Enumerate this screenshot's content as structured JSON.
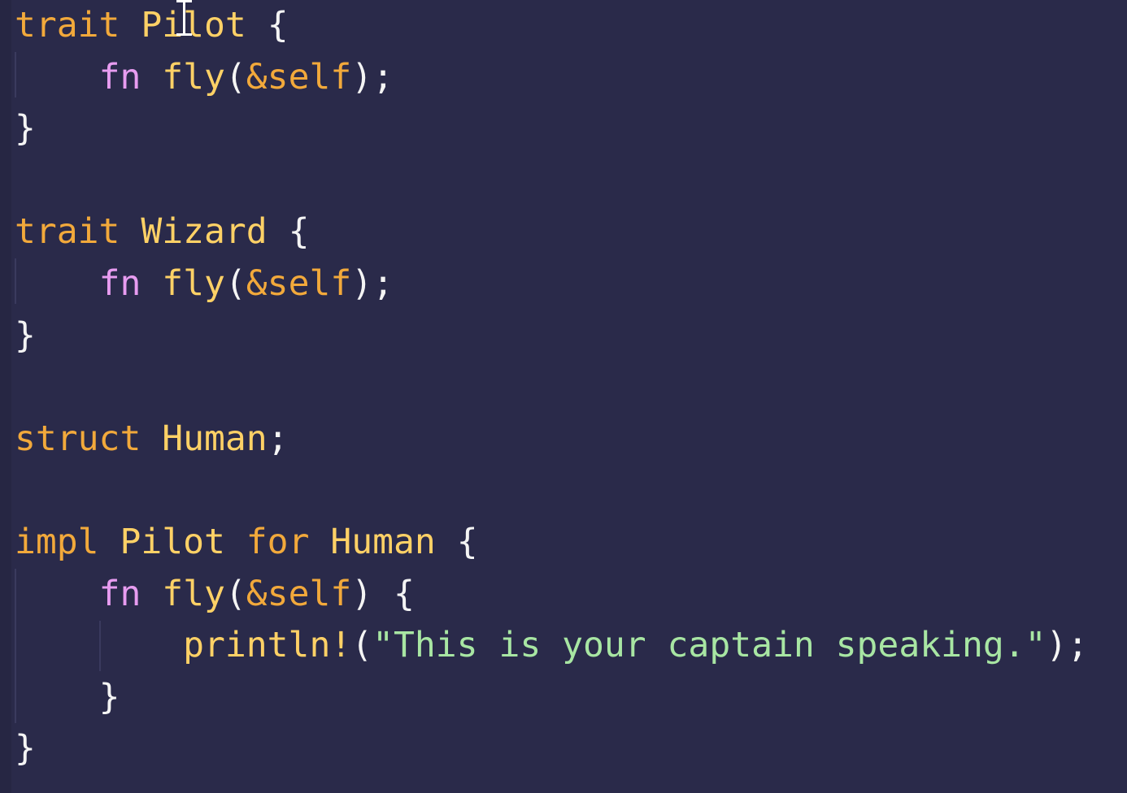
{
  "editor": {
    "language": "rust",
    "colors": {
      "background": "#2a2a4a",
      "keyword": "#f2a93b",
      "type": "#ffd166",
      "fn_keyword": "#e79cf0",
      "fn_name": "#ffd166",
      "self": "#f2a93b",
      "punct": "#f4f4f4",
      "macro": "#ffd166",
      "string": "#a8e6a3"
    },
    "lines": [
      [
        {
          "t": "trait",
          "c": "keyword"
        },
        {
          "t": " "
        },
        {
          "t": "Pilot",
          "c": "type"
        },
        {
          "t": " "
        },
        {
          "t": "{",
          "c": "punct"
        }
      ],
      [
        {
          "t": "    "
        },
        {
          "t": "fn",
          "c": "fn_keyword"
        },
        {
          "t": " "
        },
        {
          "t": "fly",
          "c": "fn_name"
        },
        {
          "t": "(",
          "c": "punct"
        },
        {
          "t": "&self",
          "c": "self"
        },
        {
          "t": ");",
          "c": "punct"
        }
      ],
      [
        {
          "t": "}",
          "c": "punct"
        }
      ],
      [],
      [
        {
          "t": "trait",
          "c": "keyword"
        },
        {
          "t": " "
        },
        {
          "t": "Wizard",
          "c": "type"
        },
        {
          "t": " "
        },
        {
          "t": "{",
          "c": "punct"
        }
      ],
      [
        {
          "t": "    "
        },
        {
          "t": "fn",
          "c": "fn_keyword"
        },
        {
          "t": " "
        },
        {
          "t": "fly",
          "c": "fn_name"
        },
        {
          "t": "(",
          "c": "punct"
        },
        {
          "t": "&self",
          "c": "self"
        },
        {
          "t": ");",
          "c": "punct"
        }
      ],
      [
        {
          "t": "}",
          "c": "punct"
        }
      ],
      [],
      [
        {
          "t": "struct",
          "c": "keyword"
        },
        {
          "t": " "
        },
        {
          "t": "Human",
          "c": "type"
        },
        {
          "t": ";",
          "c": "punct"
        }
      ],
      [],
      [
        {
          "t": "impl",
          "c": "keyword"
        },
        {
          "t": " "
        },
        {
          "t": "Pilot",
          "c": "type"
        },
        {
          "t": " "
        },
        {
          "t": "for",
          "c": "keyword"
        },
        {
          "t": " "
        },
        {
          "t": "Human",
          "c": "type"
        },
        {
          "t": " "
        },
        {
          "t": "{",
          "c": "punct"
        }
      ],
      [
        {
          "t": "    "
        },
        {
          "t": "fn",
          "c": "fn_keyword"
        },
        {
          "t": " "
        },
        {
          "t": "fly",
          "c": "fn_name"
        },
        {
          "t": "(",
          "c": "punct"
        },
        {
          "t": "&self",
          "c": "self"
        },
        {
          "t": ") {",
          "c": "punct"
        }
      ],
      [
        {
          "t": "        "
        },
        {
          "t": "println!",
          "c": "macro"
        },
        {
          "t": "(",
          "c": "punct"
        },
        {
          "t": "\"This is your captain speaking.\"",
          "c": "string"
        },
        {
          "t": ");",
          "c": "punct"
        }
      ],
      [
        {
          "t": "    "
        },
        {
          "t": "}",
          "c": "punct"
        }
      ],
      [
        {
          "t": "}",
          "c": "punct"
        }
      ]
    ]
  },
  "cursor": {
    "type": "text-cursor-icon"
  }
}
